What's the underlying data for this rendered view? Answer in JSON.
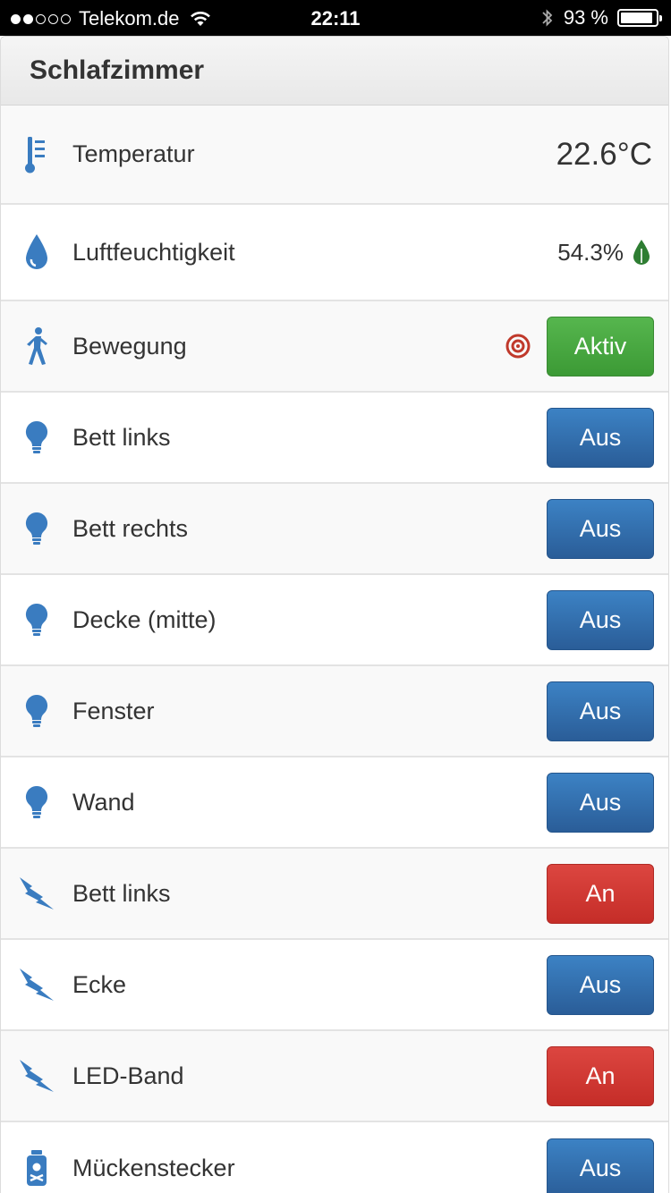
{
  "status_bar": {
    "carrier": "Telekom.de",
    "time": "22:11",
    "battery": "93 %",
    "battery_level": 0.93,
    "signal_bars": 2,
    "signal_total": 5
  },
  "panel": {
    "title": "Schlafzimmer"
  },
  "colors": {
    "icon_blue": "#3a7cc0",
    "button_blue": "#2f69aa",
    "button_green": "#47a93f",
    "button_red": "#d03a34",
    "humidity_green": "#2e7d32",
    "target_red": "#c0392b"
  },
  "sensors": {
    "temperature": {
      "label": "Temperatur",
      "value": "22.6°C",
      "icon": "thermometer-icon"
    },
    "humidity": {
      "label": "Luftfeuchtigkeit",
      "value": "54.3%",
      "icon": "water-drop-icon"
    },
    "motion": {
      "label": "Bewegung",
      "button": "Aktiv",
      "icon": "walking-person-icon"
    }
  },
  "lights": [
    {
      "label": "Bett links",
      "button": "Aus"
    },
    {
      "label": "Bett rechts",
      "button": "Aus"
    },
    {
      "label": "Decke (mitte)",
      "button": "Aus"
    },
    {
      "label": "Fenster",
      "button": "Aus"
    },
    {
      "label": "Wand",
      "button": "Aus"
    }
  ],
  "switches": [
    {
      "label": "Bett links",
      "button": "An"
    },
    {
      "label": "Ecke",
      "button": "Aus"
    },
    {
      "label": "LED-Band",
      "button": "An"
    }
  ],
  "plug": {
    "label": "Mückenstecker",
    "button": "Aus",
    "icon": "poison-bottle-icon"
  }
}
